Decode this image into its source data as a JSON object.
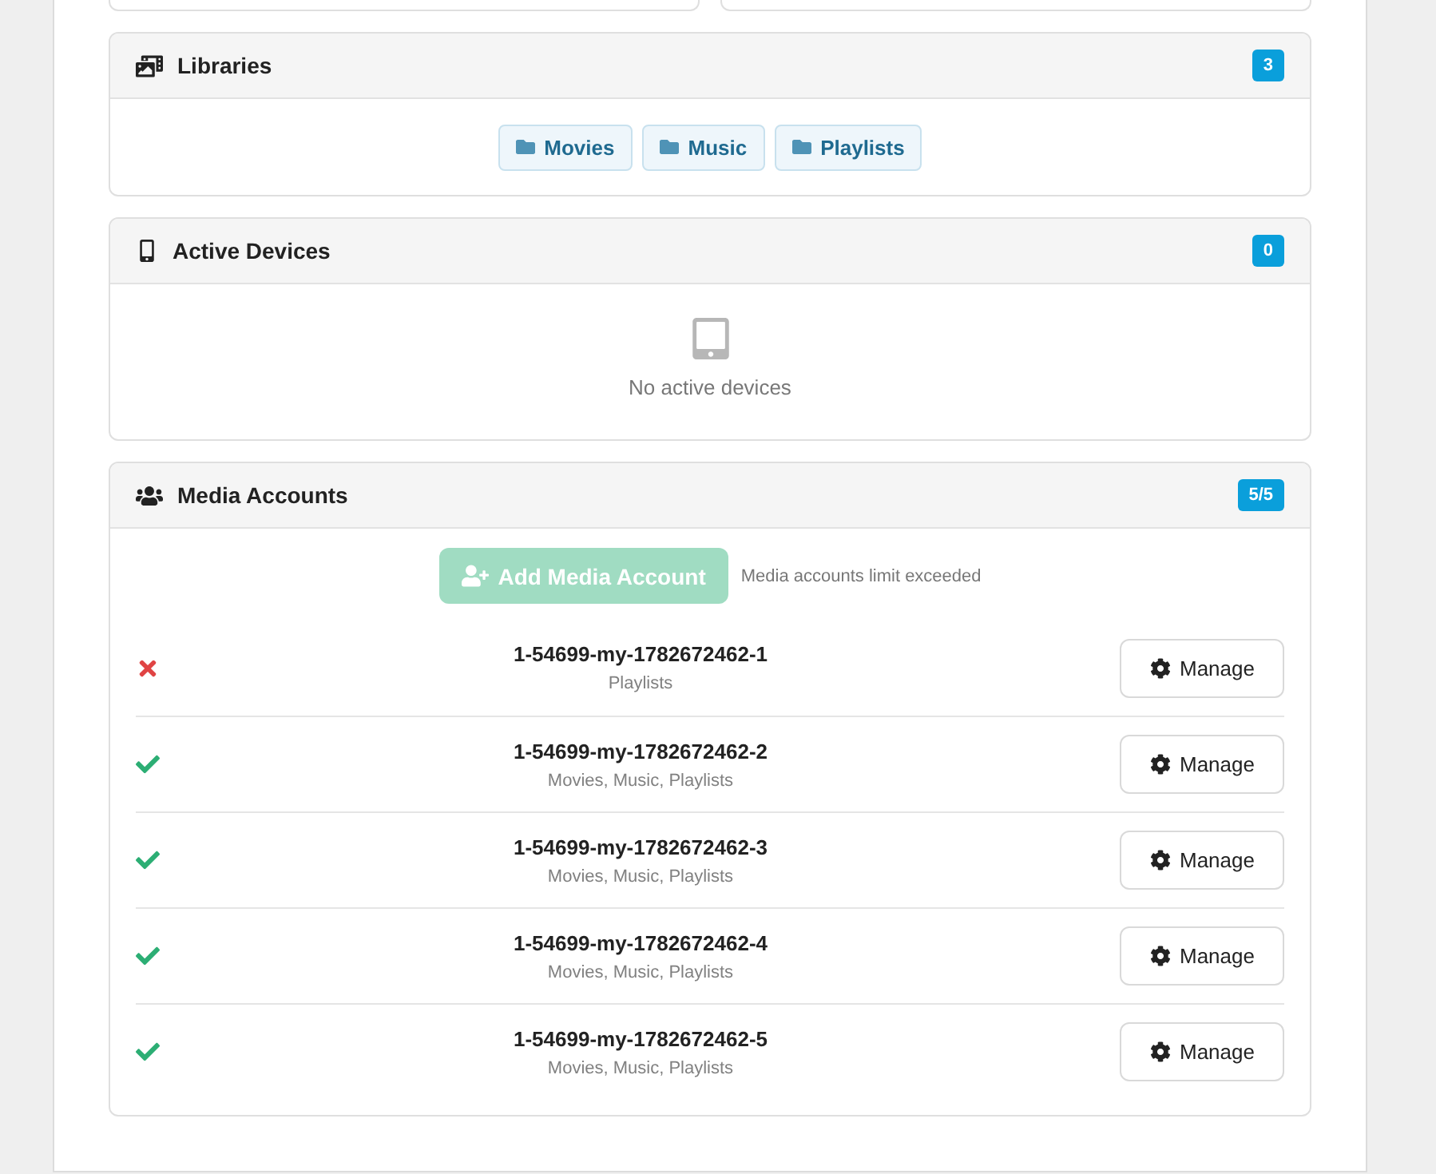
{
  "libraries": {
    "title": "Libraries",
    "count": "3",
    "items": [
      "Movies",
      "Music",
      "Playlists"
    ]
  },
  "active_devices": {
    "title": "Active Devices",
    "count": "0",
    "empty_text": "No active devices"
  },
  "media_accounts": {
    "title": "Media Accounts",
    "count": "5/5",
    "add_button": {
      "label": "Add Media Account",
      "disabled": true
    },
    "limit_note": "Media accounts limit exceeded",
    "accounts": [
      {
        "name": "1-54699-my-1782672462-1",
        "libraries": "Playlists",
        "enabled": false,
        "action": "Manage"
      },
      {
        "name": "1-54699-my-1782672462-2",
        "libraries": "Movies, Music, Playlists",
        "enabled": true,
        "action": "Manage"
      },
      {
        "name": "1-54699-my-1782672462-3",
        "libraries": "Movies, Music, Playlists",
        "enabled": true,
        "action": "Manage"
      },
      {
        "name": "1-54699-my-1782672462-4",
        "libraries": "Movies, Music, Playlists",
        "enabled": true,
        "action": "Manage"
      },
      {
        "name": "1-54699-my-1782672462-5",
        "libraries": "Movies, Music, Playlists",
        "enabled": true,
        "action": "Manage"
      }
    ]
  }
}
